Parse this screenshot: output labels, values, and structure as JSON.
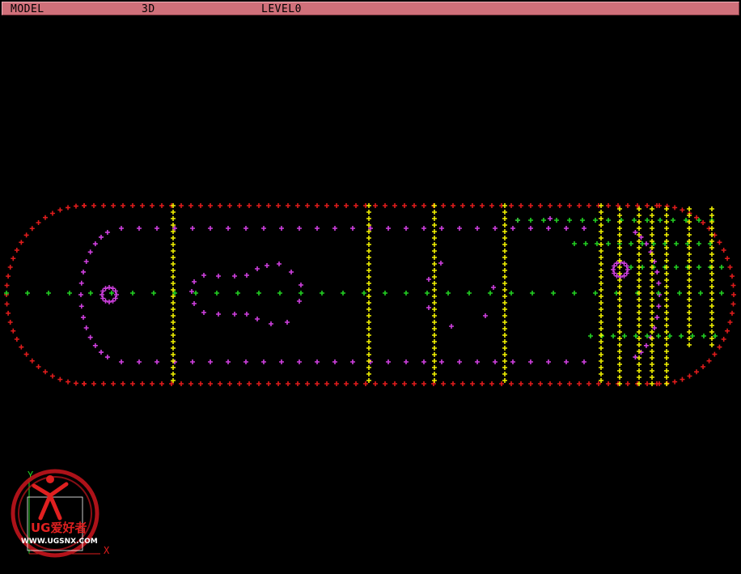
{
  "status_bar": {
    "view_label": "MODEL",
    "mode_label": "3D",
    "level_label": "LEVEL0"
  },
  "viewport": {
    "background": "#000000",
    "colors": {
      "boundary": "#e01c1c",
      "contour": "#d040e0",
      "horizontal_lines": "#22d022",
      "vertical_lines": "#f0f000"
    }
  },
  "triad": {
    "x_label": "X",
    "y_label": "Y",
    "x_color": "#e01c1c",
    "y_color": "#22d022"
  },
  "watermark": {
    "logo_text": "UG爱好者",
    "url_text": "WWW.UGSNX.COM"
  }
}
